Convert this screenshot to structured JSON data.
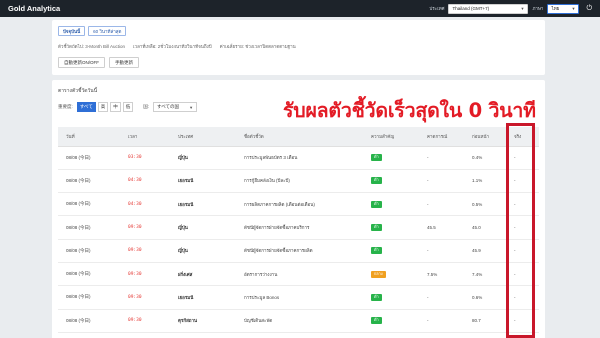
{
  "app": {
    "title": "Gold Analytica"
  },
  "topbar": {
    "timezone_label": "ประเทศ",
    "timezone_value": "Thailand (GMT+7)",
    "language_label": "ภาษา",
    "language_value": "ไทย"
  },
  "top_card": {
    "tabs": [
      "ปัจจุบันนี้",
      "60 วินาทีล่าสุด"
    ],
    "info": [
      "ตัวชี้วัดถัดไป: 3-Month Bill Auction",
      "เวลาที่เหลือ: 2ชั่วโมง4นาที3วินาทีจนถึงปี",
      "ค่าเฉลี่ยราย: ช่วงเวลาปิดตลาดตามฐาน"
    ],
    "buttons": [
      "自動更新ON/OFF",
      "手動更新"
    ]
  },
  "main": {
    "title": "ตารางตัวชี้วัดวันนี้",
    "filter_label": "重要度:",
    "filter_options": [
      "すべて",
      "高",
      "中",
      "低"
    ],
    "country_label": "国:",
    "country_value": "すべての国"
  },
  "promo_text": "รับผลตัวชี้วัดเร็วสุดใน 0 วินาที",
  "table": {
    "headers": [
      "วันที่",
      "เวลา",
      "ประเทศ",
      "ชื่อตัวชี้วัด",
      "ความสำคัญ",
      "คาดการณ์",
      "ก่อนหน้า",
      "จริง"
    ],
    "rows": [
      {
        "date": "08/08 (今日)",
        "time": "03:30",
        "country": "ญี่ปุ่น",
        "name": "การประมูลพันธบัตร 3 เดือน",
        "importance": "ต่ำ",
        "forecast": "-",
        "previous": "0.4%",
        "actual": "-"
      },
      {
        "date": "08/08 (今日)",
        "time": "04:30",
        "country": "เยอรมนี",
        "name": "การกู้ยืมคลังเงิน (ปีละปี)",
        "importance": "ต่ำ",
        "forecast": "-",
        "previous": "1.1%",
        "actual": "-"
      },
      {
        "date": "08/08 (今日)",
        "time": "04:30",
        "country": "เยอรมนี",
        "name": "การผลิตภาคการผลิต (เดือนต่อเดือน)",
        "importance": "ต่ำ",
        "forecast": "-",
        "previous": "0.5%",
        "actual": "-"
      },
      {
        "date": "08/08 (今日)",
        "time": "09:30",
        "country": "ญี่ปุ่น",
        "name": "ดัชนีผู้จัดการฝ่ายจัดซื้อภาคบริการ",
        "importance": "ต่ำ",
        "forecast": "45.5",
        "previous": "45.0",
        "actual": "-"
      },
      {
        "date": "08/08 (今日)",
        "time": "09:30",
        "country": "ญี่ปุ่น",
        "name": "ดัชนีผู้จัดการฝ่ายจัดซื้อภาคการผลิต",
        "importance": "ต่ำ",
        "forecast": "-",
        "previous": "45.9",
        "actual": "-"
      },
      {
        "date": "08/08 (今日)",
        "time": "09:30",
        "country": "ฝรั่งเศส",
        "name": "อัตราการว่างงาน",
        "importance": "กลาง",
        "forecast": "7.5%",
        "previous": "7.4%",
        "actual": "-"
      },
      {
        "date": "08/08 (今日)",
        "time": "09:30",
        "country": "เยอรมนี",
        "name": "การประมูล Bonos",
        "importance": "ต่ำ",
        "forecast": "-",
        "previous": "0.6%",
        "actual": "-"
      },
      {
        "date": "08/08 (今日)",
        "time": "09:30",
        "country": "ตุรกีสถาน",
        "name": "บัญชีเดินสะพัด",
        "importance": "ต่ำ",
        "forecast": "-",
        "previous": "80.7",
        "actual": "-"
      }
    ]
  },
  "colors": {
    "accent": "#2f6fd6",
    "highlight": "#c9172a",
    "promo": "#e31b25",
    "importance_low": "#27b34a",
    "importance_mid": "#f0a020"
  }
}
